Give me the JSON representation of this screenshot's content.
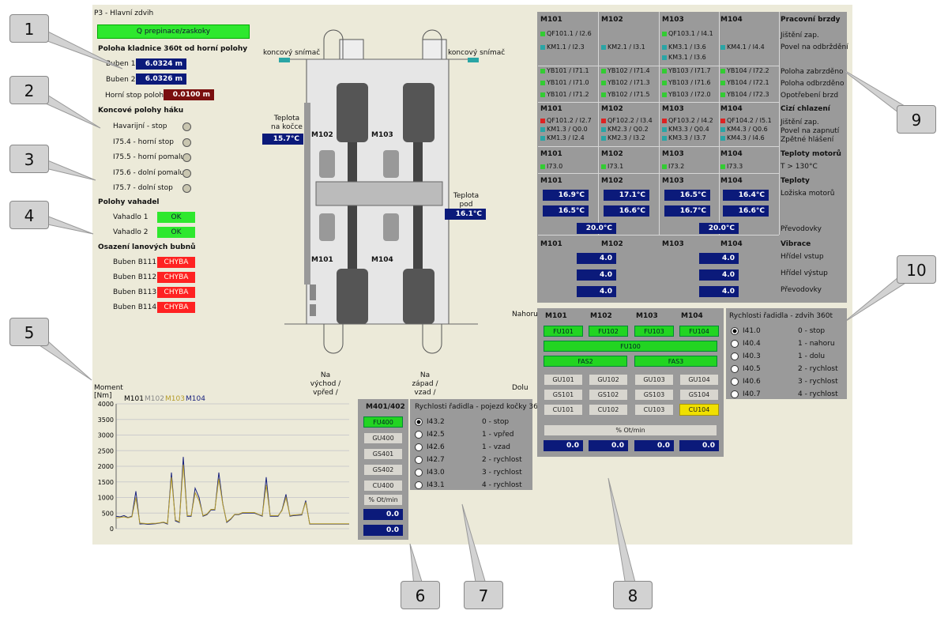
{
  "title": "P3 - Hlavní zdvih",
  "switch_btn": "Q prepinace/zaskoky",
  "hook_position": {
    "header": "Poloha kladnice 360t od horní polohy",
    "buben1_label": "Buben 1",
    "buben1_value": "6.0324 m",
    "buben2_label": "Buben 2",
    "buben2_value": "6.0326 m",
    "stop_label": "Horní stop poloha",
    "stop_value": "0.0100 m"
  },
  "limits": {
    "header": "Koncové polohy háku",
    "items": [
      "Havarijní - stop",
      "I75.4 - horní stop",
      "I75.5 - horní pomalu",
      "I75.6 - dolní pomalu",
      "I75.7 - dolní stop"
    ]
  },
  "winches": {
    "header": "Polohy vahadel",
    "items": [
      {
        "label": "Vahadlo 1",
        "status": "OK"
      },
      {
        "label": "Vahadlo 2",
        "status": "OK"
      }
    ]
  },
  "drums": {
    "header": "Osazení lanových bubnů",
    "items": [
      {
        "label": "Buben B111",
        "status": "CHYBA"
      },
      {
        "label": "Buben B112",
        "status": "CHYBA"
      },
      {
        "label": "Buben B113",
        "status": "CHYBA"
      },
      {
        "label": "Buben B114",
        "status": "CHYBA"
      }
    ]
  },
  "crane": {
    "sensor_left": "koncový snímač",
    "sensor_right": "koncový snímač",
    "temp_cab_label": "Teplota na kočce",
    "temp_cab_value": "15.7°C",
    "temp_under_label": "Teplota pod kočkou",
    "temp_under_value": "16.1°C",
    "m102": "M102",
    "m103": "M103",
    "m101": "M101",
    "m104": "M104",
    "east": "Na východ / vpřed /",
    "west": "Na západ / vzad /",
    "up": "Nahoru",
    "down": "Dolu"
  },
  "chart_data": {
    "type": "line",
    "title": "Moment [Nm]",
    "legend": [
      "M101",
      "M102",
      "M103",
      "M104"
    ],
    "colors": [
      "#000000",
      "#888888",
      "#b59c2a",
      "#1a237e"
    ],
    "y_ticks": [
      4000,
      3500,
      3000,
      2500,
      2000,
      1500,
      1000,
      500,
      0
    ],
    "ylim": [
      0,
      4000
    ],
    "series": [
      {
        "name": "M104",
        "values": [
          400,
          380,
          420,
          360,
          400,
          1200,
          150,
          160,
          140,
          150,
          160,
          180,
          200,
          150,
          1800,
          250,
          200,
          2300,
          400,
          400,
          1300,
          1000,
          400,
          450,
          600,
          600,
          1800,
          800,
          200,
          300,
          450,
          450,
          500,
          500,
          500,
          500,
          450,
          400,
          1650,
          400,
          400,
          400,
          600,
          1100,
          400,
          420,
          430,
          440,
          900,
          150,
          150,
          150,
          150,
          150,
          150,
          150,
          150,
          150,
          150,
          150
        ]
      },
      {
        "name": "M103",
        "values": [
          350,
          360,
          380,
          350,
          380,
          1000,
          180,
          170,
          160,
          170,
          170,
          190,
          210,
          170,
          1650,
          280,
          220,
          2050,
          420,
          420,
          1150,
          900,
          420,
          470,
          620,
          620,
          1600,
          780,
          220,
          320,
          460,
          460,
          520,
          520,
          520,
          520,
          460,
          420,
          1400,
          420,
          420,
          420,
          580,
          1000,
          420,
          440,
          450,
          460,
          850,
          160,
          160,
          160,
          160,
          160,
          160,
          160,
          160,
          160,
          160,
          160
        ]
      }
    ]
  },
  "gantry": {
    "header": "M401/402",
    "buttons": [
      "FU400",
      "GU400",
      "GS401",
      "GS402",
      "CU400"
    ],
    "pct": "% Ot/min",
    "v1": "0.0",
    "v2": "0.0"
  },
  "trolley_speed": {
    "header": "Rychlosti řadidla - pojezd kočky 360t",
    "rows": [
      [
        "I43.2",
        "0 - stop"
      ],
      [
        "I42.5",
        "1 - vpřed"
      ],
      [
        "I42.6",
        "1 - vzad"
      ],
      [
        "I42.7",
        "2 - rychlost"
      ],
      [
        "I43.0",
        "3 - rychlost"
      ],
      [
        "I43.1",
        "4 - rychlost"
      ]
    ]
  },
  "hoist_speed": {
    "header": "Rychlosti řadidla - zdvih 360t",
    "rows": [
      [
        "I41.0",
        "0 - stop"
      ],
      [
        "I40.4",
        "1 - nahoru"
      ],
      [
        "I40.3",
        "1 - dolu"
      ],
      [
        "I40.5",
        "2 - rychlost"
      ],
      [
        "I40.6",
        "3 - rychlost"
      ],
      [
        "I40.7",
        "4 - rychlost"
      ]
    ]
  },
  "drives": {
    "motors": [
      "M101",
      "M102",
      "M103",
      "M104"
    ],
    "row1": [
      "FU101",
      "FU102",
      "FU103",
      "FU104"
    ],
    "fu100": "FU100",
    "fas2": "FAS2",
    "fas3": "FAS3",
    "gu": [
      "GU101",
      "GU102",
      "GU103",
      "GU104"
    ],
    "gs": [
      "GS101",
      "GS102",
      "GS103",
      "GS104"
    ],
    "cu": [
      "CU101",
      "CU102",
      "CU103",
      "CU104"
    ],
    "pct": "% Ot/min",
    "vals": [
      "0.0",
      "0.0",
      "0.0",
      "0.0"
    ]
  },
  "status": {
    "motors": [
      "M101",
      "M102",
      "M103",
      "M104"
    ],
    "brakes_title": "Pracovní brzdy",
    "brake_labels": [
      "Jištění zap.",
      "Povel na odbrždění"
    ],
    "brake_c1": [
      "QF101.1 / I2.6",
      "KM1.1 / I2.3"
    ],
    "brake_c2": [
      "",
      "KM2.1 / I3.1"
    ],
    "brake_c3": [
      "QF103.1 / I4.1",
      "KM3.1 / I3.6",
      "KM3.1 / I3.6"
    ],
    "brake_c4": [
      "",
      "KM4.1 / I4.4"
    ],
    "yb_labels": [
      "Poloha zabrzděno",
      "Poloha odbrzděno",
      "Opotřebení brzd"
    ],
    "yb": [
      [
        "YB101 / I71.1",
        "YB101 / I71.0",
        "YB101 / I71.2"
      ],
      [
        "YB102 / I71.4",
        "YB102 / I71.3",
        "YB102 / I71.5"
      ],
      [
        "YB103 / I71.7",
        "YB103 / I71.6",
        "YB103 / I72.0"
      ],
      [
        "YB104 / I72.2",
        "YB104 / I72.1",
        "YB104 / I72.3"
      ]
    ],
    "cool_title": "Cizí chlazení",
    "cool_labels": [
      "Jištění zap.",
      "Povel na zapnutí",
      "Zpětné hlášení"
    ],
    "cool": [
      [
        "QF101.2 / I2.7",
        "KM1.3 / Q0.0",
        "KM1.3 / I2.4"
      ],
      [
        "QF102.2 / I3.4",
        "KM2.3 / Q0.2",
        "KM2.3 / I3.2"
      ],
      [
        "QF103.2 / I4.2",
        "KM3.3 / Q0.4",
        "KM3.3 / I3.7"
      ],
      [
        "QF104.2 / I5.1",
        "KM4.3 / Q0.6",
        "KM4.3 / I4.6"
      ]
    ],
    "temp_title": "Teploty motorů",
    "temp_label": "T > 130°C",
    "temp_in": [
      "I73.0",
      "I73.1",
      "I73.2",
      "I73.3"
    ],
    "t2_title": "Teploty",
    "t2_label": "Ložiska motorů",
    "t2_row1": [
      "16.9°C",
      "17.1°C",
      "16.5°C",
      "16.4°C"
    ],
    "t2_row2": [
      "16.5°C",
      "16.6°C",
      "16.7°C",
      "16.6°C"
    ],
    "gear_label": "Převodovky",
    "gear_vals": [
      "20.0°C",
      "20.0°C"
    ],
    "vib_title": "Vibrace",
    "vib_labels": [
      "Hřídel vstup",
      "Hřídel výstup",
      "Převodovky"
    ],
    "vib_vals": [
      "4.0",
      "4.0",
      "4.0",
      "4.0",
      "4.0",
      "4.0"
    ]
  },
  "callouts": [
    "1",
    "2",
    "3",
    "4",
    "5",
    "6",
    "7",
    "8",
    "9",
    "10"
  ]
}
